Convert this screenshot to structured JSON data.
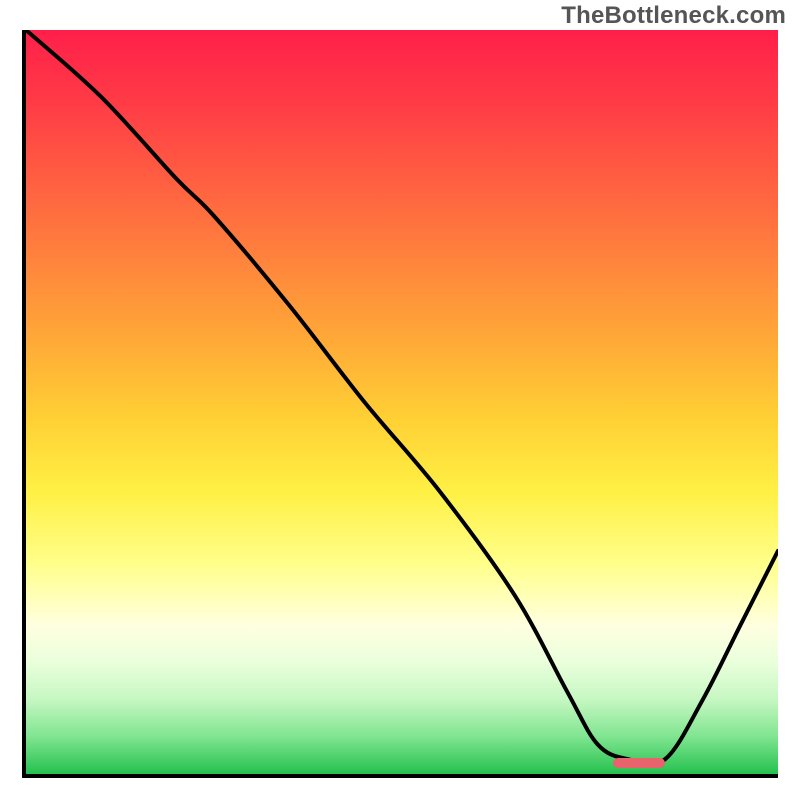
{
  "watermark": "TheBottleneck.com",
  "colors": {
    "axis": "#000000",
    "curve": "#000000",
    "marker": "#e9636d",
    "gradient_stops": [
      "#ff1f4a",
      "#ff3c46",
      "#ff6f3f",
      "#ffa338",
      "#ffcf34",
      "#fff044",
      "#ffff8c",
      "#ffffe0",
      "#eaffdc",
      "#c6f7c2",
      "#7fe590",
      "#24c14e"
    ]
  },
  "chart_data": {
    "type": "line",
    "title": "",
    "xlabel": "",
    "ylabel": "",
    "xlim": [
      0,
      100
    ],
    "ylim": [
      0,
      100
    ],
    "grid": false,
    "legend": false,
    "annotations": [
      "TheBottleneck.com"
    ],
    "series": [
      {
        "name": "curve",
        "x": [
          0,
          10,
          20,
          25,
          35,
          45,
          55,
          65,
          72,
          76,
          80,
          85,
          90,
          95,
          100
        ],
        "y": [
          100,
          91,
          80,
          75,
          63,
          50,
          38,
          24,
          11,
          4,
          2,
          2,
          10,
          20,
          30
        ]
      }
    ],
    "marker": {
      "x_start": 78,
      "x_end": 85,
      "y": 1.5
    }
  }
}
